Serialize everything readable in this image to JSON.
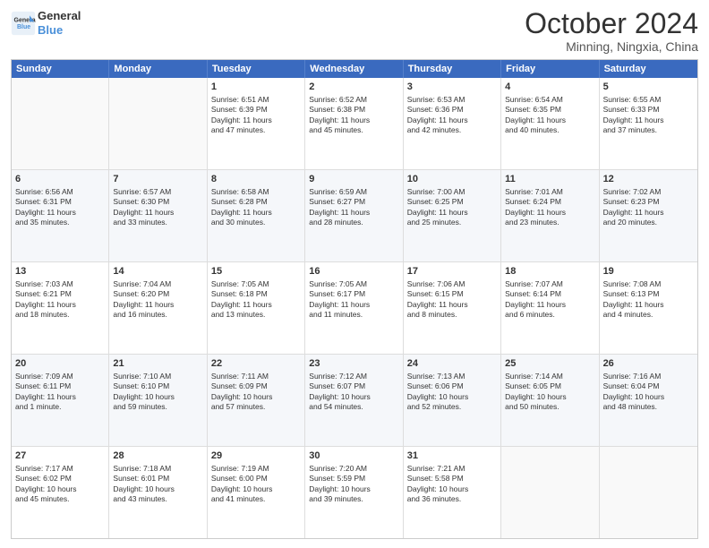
{
  "logo": {
    "line1": "General",
    "line2": "Blue",
    "alt": "GeneralBlue logo"
  },
  "title": "October 2024",
  "subtitle": "Minning, Ningxia, China",
  "weekdays": [
    "Sunday",
    "Monday",
    "Tuesday",
    "Wednesday",
    "Thursday",
    "Friday",
    "Saturday"
  ],
  "rows": [
    [
      {
        "day": "",
        "empty": true,
        "lines": []
      },
      {
        "day": "",
        "empty": true,
        "lines": []
      },
      {
        "day": "1",
        "empty": false,
        "lines": [
          "Sunrise: 6:51 AM",
          "Sunset: 6:39 PM",
          "Daylight: 11 hours",
          "and 47 minutes."
        ]
      },
      {
        "day": "2",
        "empty": false,
        "lines": [
          "Sunrise: 6:52 AM",
          "Sunset: 6:38 PM",
          "Daylight: 11 hours",
          "and 45 minutes."
        ]
      },
      {
        "day": "3",
        "empty": false,
        "lines": [
          "Sunrise: 6:53 AM",
          "Sunset: 6:36 PM",
          "Daylight: 11 hours",
          "and 42 minutes."
        ]
      },
      {
        "day": "4",
        "empty": false,
        "lines": [
          "Sunrise: 6:54 AM",
          "Sunset: 6:35 PM",
          "Daylight: 11 hours",
          "and 40 minutes."
        ]
      },
      {
        "day": "5",
        "empty": false,
        "lines": [
          "Sunrise: 6:55 AM",
          "Sunset: 6:33 PM",
          "Daylight: 11 hours",
          "and 37 minutes."
        ]
      }
    ],
    [
      {
        "day": "6",
        "empty": false,
        "lines": [
          "Sunrise: 6:56 AM",
          "Sunset: 6:31 PM",
          "Daylight: 11 hours",
          "and 35 minutes."
        ]
      },
      {
        "day": "7",
        "empty": false,
        "lines": [
          "Sunrise: 6:57 AM",
          "Sunset: 6:30 PM",
          "Daylight: 11 hours",
          "and 33 minutes."
        ]
      },
      {
        "day": "8",
        "empty": false,
        "lines": [
          "Sunrise: 6:58 AM",
          "Sunset: 6:28 PM",
          "Daylight: 11 hours",
          "and 30 minutes."
        ]
      },
      {
        "day": "9",
        "empty": false,
        "lines": [
          "Sunrise: 6:59 AM",
          "Sunset: 6:27 PM",
          "Daylight: 11 hours",
          "and 28 minutes."
        ]
      },
      {
        "day": "10",
        "empty": false,
        "lines": [
          "Sunrise: 7:00 AM",
          "Sunset: 6:25 PM",
          "Daylight: 11 hours",
          "and 25 minutes."
        ]
      },
      {
        "day": "11",
        "empty": false,
        "lines": [
          "Sunrise: 7:01 AM",
          "Sunset: 6:24 PM",
          "Daylight: 11 hours",
          "and 23 minutes."
        ]
      },
      {
        "day": "12",
        "empty": false,
        "lines": [
          "Sunrise: 7:02 AM",
          "Sunset: 6:23 PM",
          "Daylight: 11 hours",
          "and 20 minutes."
        ]
      }
    ],
    [
      {
        "day": "13",
        "empty": false,
        "lines": [
          "Sunrise: 7:03 AM",
          "Sunset: 6:21 PM",
          "Daylight: 11 hours",
          "and 18 minutes."
        ]
      },
      {
        "day": "14",
        "empty": false,
        "lines": [
          "Sunrise: 7:04 AM",
          "Sunset: 6:20 PM",
          "Daylight: 11 hours",
          "and 16 minutes."
        ]
      },
      {
        "day": "15",
        "empty": false,
        "lines": [
          "Sunrise: 7:05 AM",
          "Sunset: 6:18 PM",
          "Daylight: 11 hours",
          "and 13 minutes."
        ]
      },
      {
        "day": "16",
        "empty": false,
        "lines": [
          "Sunrise: 7:05 AM",
          "Sunset: 6:17 PM",
          "Daylight: 11 hours",
          "and 11 minutes."
        ]
      },
      {
        "day": "17",
        "empty": false,
        "lines": [
          "Sunrise: 7:06 AM",
          "Sunset: 6:15 PM",
          "Daylight: 11 hours",
          "and 8 minutes."
        ]
      },
      {
        "day": "18",
        "empty": false,
        "lines": [
          "Sunrise: 7:07 AM",
          "Sunset: 6:14 PM",
          "Daylight: 11 hours",
          "and 6 minutes."
        ]
      },
      {
        "day": "19",
        "empty": false,
        "lines": [
          "Sunrise: 7:08 AM",
          "Sunset: 6:13 PM",
          "Daylight: 11 hours",
          "and 4 minutes."
        ]
      }
    ],
    [
      {
        "day": "20",
        "empty": false,
        "lines": [
          "Sunrise: 7:09 AM",
          "Sunset: 6:11 PM",
          "Daylight: 11 hours",
          "and 1 minute."
        ]
      },
      {
        "day": "21",
        "empty": false,
        "lines": [
          "Sunrise: 7:10 AM",
          "Sunset: 6:10 PM",
          "Daylight: 10 hours",
          "and 59 minutes."
        ]
      },
      {
        "day": "22",
        "empty": false,
        "lines": [
          "Sunrise: 7:11 AM",
          "Sunset: 6:09 PM",
          "Daylight: 10 hours",
          "and 57 minutes."
        ]
      },
      {
        "day": "23",
        "empty": false,
        "lines": [
          "Sunrise: 7:12 AM",
          "Sunset: 6:07 PM",
          "Daylight: 10 hours",
          "and 54 minutes."
        ]
      },
      {
        "day": "24",
        "empty": false,
        "lines": [
          "Sunrise: 7:13 AM",
          "Sunset: 6:06 PM",
          "Daylight: 10 hours",
          "and 52 minutes."
        ]
      },
      {
        "day": "25",
        "empty": false,
        "lines": [
          "Sunrise: 7:14 AM",
          "Sunset: 6:05 PM",
          "Daylight: 10 hours",
          "and 50 minutes."
        ]
      },
      {
        "day": "26",
        "empty": false,
        "lines": [
          "Sunrise: 7:16 AM",
          "Sunset: 6:04 PM",
          "Daylight: 10 hours",
          "and 48 minutes."
        ]
      }
    ],
    [
      {
        "day": "27",
        "empty": false,
        "lines": [
          "Sunrise: 7:17 AM",
          "Sunset: 6:02 PM",
          "Daylight: 10 hours",
          "and 45 minutes."
        ]
      },
      {
        "day": "28",
        "empty": false,
        "lines": [
          "Sunrise: 7:18 AM",
          "Sunset: 6:01 PM",
          "Daylight: 10 hours",
          "and 43 minutes."
        ]
      },
      {
        "day": "29",
        "empty": false,
        "lines": [
          "Sunrise: 7:19 AM",
          "Sunset: 6:00 PM",
          "Daylight: 10 hours",
          "and 41 minutes."
        ]
      },
      {
        "day": "30",
        "empty": false,
        "lines": [
          "Sunrise: 7:20 AM",
          "Sunset: 5:59 PM",
          "Daylight: 10 hours",
          "and 39 minutes."
        ]
      },
      {
        "day": "31",
        "empty": false,
        "lines": [
          "Sunrise: 7:21 AM",
          "Sunset: 5:58 PM",
          "Daylight: 10 hours",
          "and 36 minutes."
        ]
      },
      {
        "day": "",
        "empty": true,
        "lines": []
      },
      {
        "day": "",
        "empty": true,
        "lines": []
      }
    ]
  ]
}
